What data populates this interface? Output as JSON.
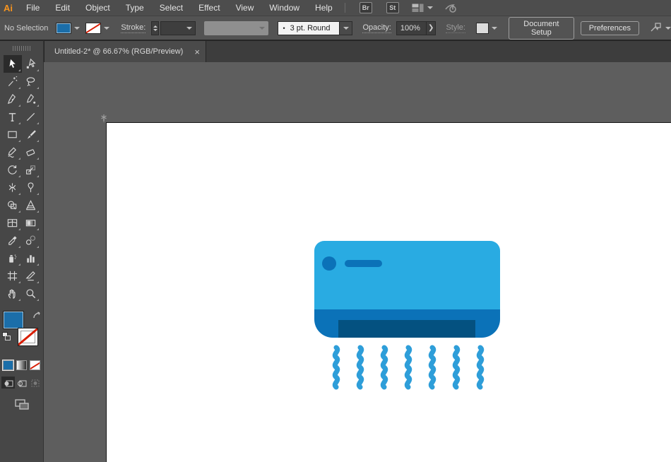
{
  "app": {
    "logo_text": "Ai"
  },
  "menubar": {
    "items": [
      "File",
      "Edit",
      "Object",
      "Type",
      "Select",
      "Effect",
      "View",
      "Window",
      "Help"
    ],
    "bridge_label": "Br",
    "stock_label": "St"
  },
  "controlbar": {
    "selection_label": "No Selection",
    "fill_color": "#1B6EA9",
    "stroke_label": "Stroke:",
    "brush_bullet": "•",
    "brush_name": "3 pt. Round",
    "opacity_label": "Opacity:",
    "opacity_value": "100%",
    "opacity_more_glyph": "❯",
    "style_label": "Style:",
    "document_setup_label": "Document Setup",
    "preferences_label": "Preferences"
  },
  "document_tab": {
    "title": "Untitled-2* @ 66.67% (RGB/Preview)",
    "close_glyph": "×"
  },
  "toolbar": {
    "selected_tool": "selection",
    "fill_color": "#1B6EA9",
    "tools": [
      "selection",
      "direct-selection",
      "magic-wand",
      "lasso",
      "pen",
      "curvature",
      "type",
      "line-segment",
      "rectangle",
      "paintbrush",
      "shaper",
      "eraser",
      "rotate",
      "scale",
      "width",
      "free-transform",
      "shape-builder",
      "perspective-grid",
      "mesh",
      "gradient",
      "eyedropper",
      "blend",
      "symbol-sprayer",
      "column-graph",
      "artboard",
      "slice",
      "hand",
      "zoom"
    ]
  },
  "canvas": {
    "background_color": "#5E5E5E",
    "artboard_color": "#FFFFFF"
  },
  "illustration": {
    "name": "air-conditioner",
    "colors": {
      "body": "#29ABE2",
      "panel": "#0B72B8",
      "vent": "#045180",
      "airflow": "#2E9ED9"
    },
    "airflow_lines": 7
  }
}
